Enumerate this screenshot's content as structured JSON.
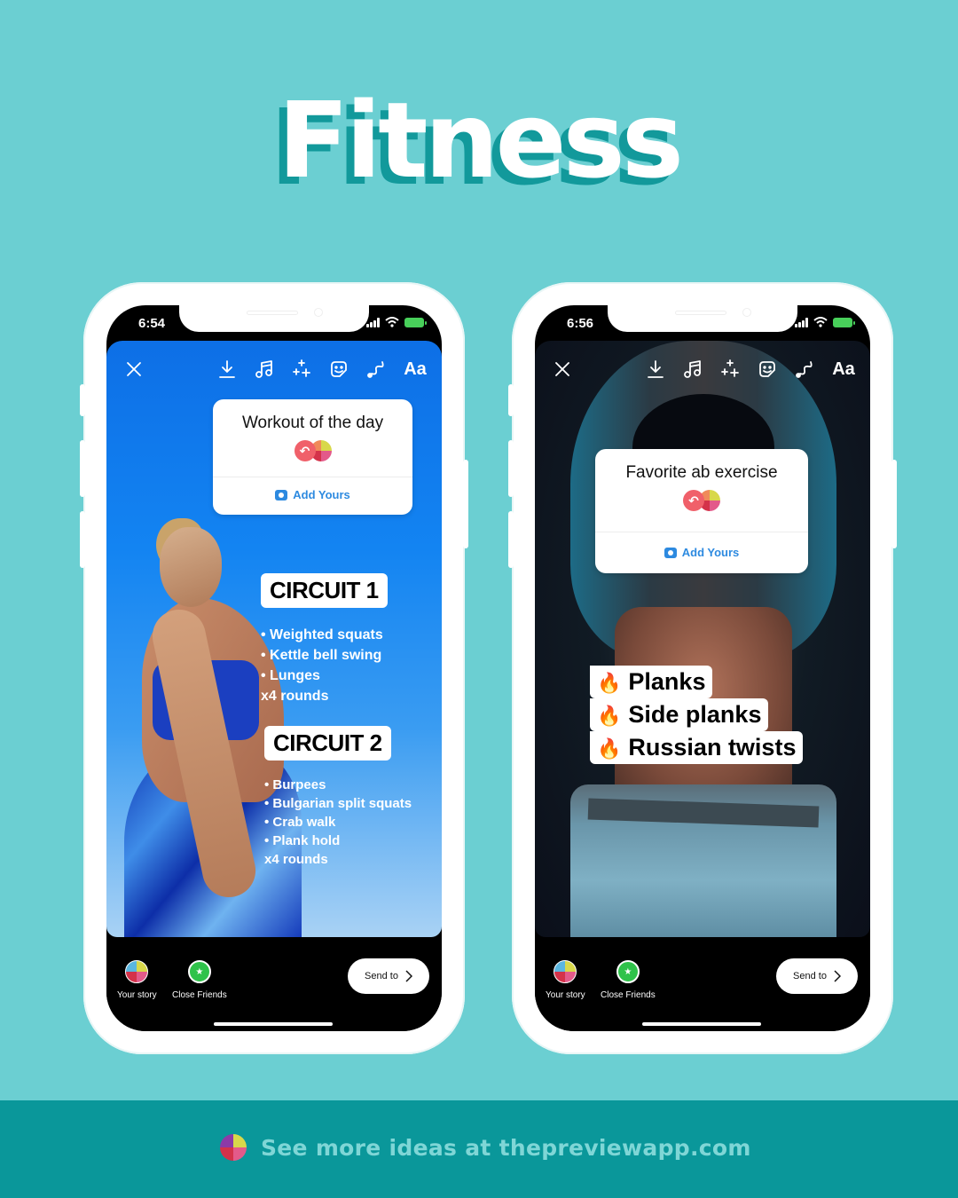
{
  "title": "Fitness",
  "colors": {
    "background": "#6bcfd2",
    "title_shadow": "#12999b",
    "footer_bg": "#0a979a",
    "footer_text": "#7fd6d6",
    "add_yours_blue": "#2d8ae0",
    "close_friends_green": "#2fc24a"
  },
  "phones": [
    {
      "status_time": "6:54",
      "toolbar": {
        "close_icon": "close-icon",
        "icons": [
          "download-icon",
          "music-icon",
          "effects-sparkle-icon",
          "sticker-icon",
          "draw-icon"
        ],
        "text_button": "Aa"
      },
      "add_yours": {
        "prompt": "Workout of the day",
        "button": "Add Yours"
      },
      "circuits": [
        {
          "label": "CIRCUIT 1",
          "items": [
            "• Weighted squats",
            "• Kettle bell swing",
            "• Lunges"
          ],
          "rounds": "x4 rounds"
        },
        {
          "label": "CIRCUIT 2",
          "items": [
            "• Burpees",
            "• Bulgarian split squats",
            "• Crab walk",
            "• Plank hold"
          ],
          "rounds": "x4 rounds"
        }
      ],
      "bottom": {
        "your_story": "Your story",
        "close_friends": "Close Friends",
        "send_to": "Send to"
      }
    },
    {
      "status_time": "6:56",
      "toolbar": {
        "close_icon": "close-icon",
        "icons": [
          "download-icon",
          "music-icon",
          "effects-sparkle-icon",
          "sticker-icon",
          "draw-icon"
        ],
        "text_button": "Aa"
      },
      "add_yours": {
        "prompt": "Favorite ab exercise",
        "button": "Add Yours"
      },
      "exercises": [
        {
          "emoji": "🔥",
          "label": "Planks"
        },
        {
          "emoji": "🔥",
          "label": "Side planks"
        },
        {
          "emoji": "🔥",
          "label": "Russian twists"
        }
      ],
      "bottom": {
        "your_story": "Your story",
        "close_friends": "Close Friends",
        "send_to": "Send to"
      }
    }
  ],
  "footer": {
    "text": "See more ideas at thepreviewapp.com"
  }
}
